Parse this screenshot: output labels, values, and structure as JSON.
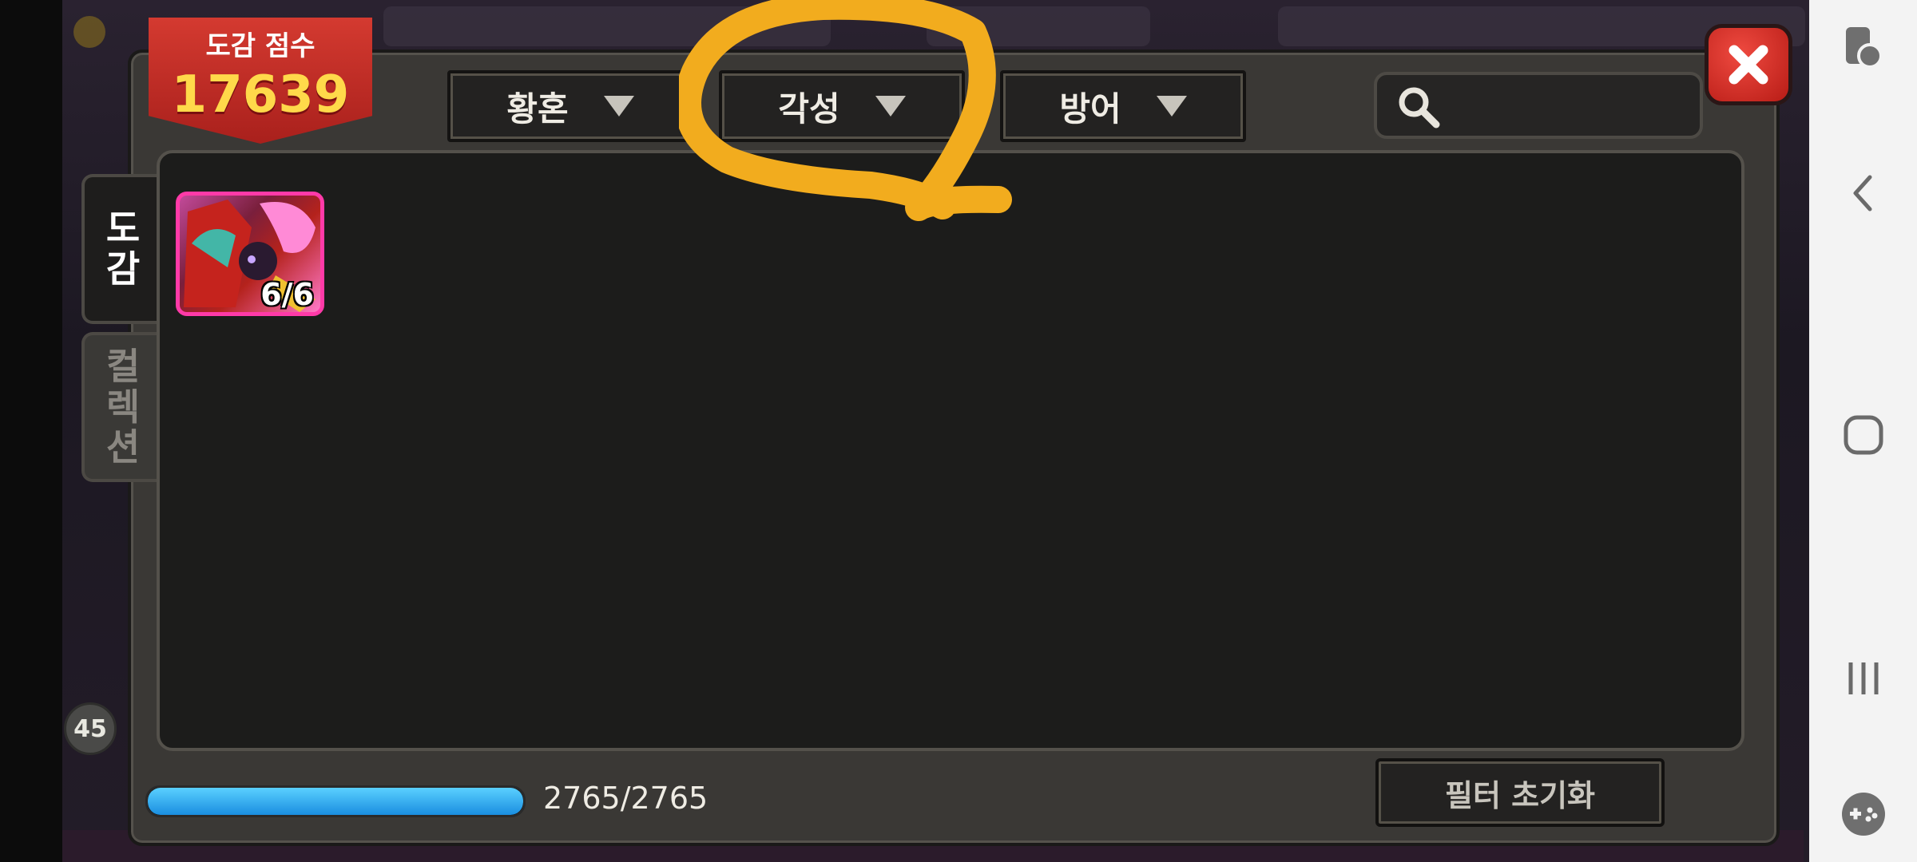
{
  "score_banner": {
    "label": "도감 점수",
    "score": "17639"
  },
  "filters": [
    {
      "label": "황혼"
    },
    {
      "label": "각성"
    },
    {
      "label": "방어"
    }
  ],
  "search": {
    "placeholder": ""
  },
  "side_tabs": [
    {
      "label_lines": [
        "도",
        "감"
      ],
      "active": true
    },
    {
      "label_lines": [
        "컬",
        "렉",
        "션"
      ],
      "active": false
    }
  ],
  "items": [
    {
      "count": "6/6"
    }
  ],
  "progress": {
    "text": "2765/2765",
    "fraction": 1.0
  },
  "reset_button": {
    "label": "필터 초기화"
  },
  "background": {
    "badge_number": "45"
  },
  "colors": {
    "banner_red": "#c32a22",
    "score_gold": "#ffd94a",
    "annotation_orange": "#f2ac1e",
    "progress_blue": "#22a7f0",
    "card_border_pink": "#ff3aa8"
  },
  "icons": {
    "close": "close-x-icon",
    "search": "magnifier-icon",
    "nav": [
      "screen-touch-icon",
      "back-icon",
      "home-icon",
      "recents-icon",
      "game-controller-icon"
    ]
  }
}
